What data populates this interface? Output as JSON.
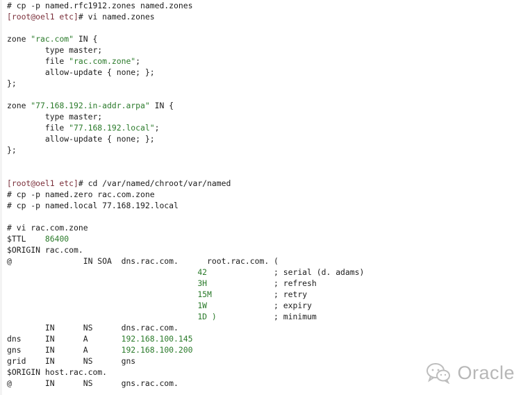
{
  "terminal": {
    "lines": [
      {
        "segments": [
          {
            "t": "# cp -p named.rfc1912.zones named.zones",
            "c": "plain"
          }
        ]
      },
      {
        "segments": [
          {
            "t": "[root@oel1 etc]",
            "c": "prompt"
          },
          {
            "t": "# vi named.zones",
            "c": "plain"
          }
        ]
      },
      {
        "segments": []
      },
      {
        "segments": [
          {
            "t": "zone ",
            "c": "plain"
          },
          {
            "t": "\"rac.com\"",
            "c": "string"
          },
          {
            "t": " IN {",
            "c": "plain"
          }
        ]
      },
      {
        "segments": [
          {
            "t": "        type master;",
            "c": "plain"
          }
        ]
      },
      {
        "segments": [
          {
            "t": "        file ",
            "c": "plain"
          },
          {
            "t": "\"rac.com.zone\"",
            "c": "string"
          },
          {
            "t": ";",
            "c": "plain"
          }
        ]
      },
      {
        "segments": [
          {
            "t": "        allow-update { none; };",
            "c": "plain"
          }
        ]
      },
      {
        "segments": [
          {
            "t": "};",
            "c": "plain"
          }
        ]
      },
      {
        "segments": []
      },
      {
        "segments": [
          {
            "t": "zone ",
            "c": "plain"
          },
          {
            "t": "\"77.168.192.in-addr.arpa\"",
            "c": "string"
          },
          {
            "t": " IN {",
            "c": "plain"
          }
        ]
      },
      {
        "segments": [
          {
            "t": "        type master;",
            "c": "plain"
          }
        ]
      },
      {
        "segments": [
          {
            "t": "        file ",
            "c": "plain"
          },
          {
            "t": "\"77.168.192.local\"",
            "c": "string"
          },
          {
            "t": ";",
            "c": "plain"
          }
        ]
      },
      {
        "segments": [
          {
            "t": "        allow-update { none; };",
            "c": "plain"
          }
        ]
      },
      {
        "segments": [
          {
            "t": "};",
            "c": "plain"
          }
        ]
      },
      {
        "segments": []
      },
      {
        "segments": []
      },
      {
        "segments": [
          {
            "t": "[root@oel1 etc]",
            "c": "prompt"
          },
          {
            "t": "# cd /var/named/chroot/var/named",
            "c": "plain"
          }
        ]
      },
      {
        "segments": [
          {
            "t": "# cp -p named.zero rac.com.zone",
            "c": "plain"
          }
        ]
      },
      {
        "segments": [
          {
            "t": "# cp -p named.local 77.168.192.local",
            "c": "plain"
          }
        ]
      },
      {
        "segments": []
      },
      {
        "segments": [
          {
            "t": "# vi rac.com.zone",
            "c": "plain"
          }
        ]
      },
      {
        "segments": [
          {
            "t": "$TTL    ",
            "c": "plain"
          },
          {
            "t": "86400",
            "c": "string"
          }
        ]
      },
      {
        "segments": [
          {
            "t": "$ORIGIN rac.com.",
            "c": "plain"
          }
        ]
      },
      {
        "segments": [
          {
            "t": "@               IN SOA  dns.rac.com.      root.rac.com. (",
            "c": "plain"
          }
        ]
      },
      {
        "segments": [
          {
            "t": "                                        ",
            "c": "plain"
          },
          {
            "t": "42",
            "c": "string"
          },
          {
            "t": "              ; serial (d. adams)",
            "c": "plain"
          }
        ]
      },
      {
        "segments": [
          {
            "t": "                                        ",
            "c": "plain"
          },
          {
            "t": "3H",
            "c": "string"
          },
          {
            "t": "              ; refresh",
            "c": "plain"
          }
        ]
      },
      {
        "segments": [
          {
            "t": "                                        ",
            "c": "plain"
          },
          {
            "t": "15M",
            "c": "string"
          },
          {
            "t": "             ; retry",
            "c": "plain"
          }
        ]
      },
      {
        "segments": [
          {
            "t": "                                        ",
            "c": "plain"
          },
          {
            "t": "1W",
            "c": "string"
          },
          {
            "t": "              ; expiry",
            "c": "plain"
          }
        ]
      },
      {
        "segments": [
          {
            "t": "                                        ",
            "c": "plain"
          },
          {
            "t": "1D )",
            "c": "string"
          },
          {
            "t": "            ; minimum",
            "c": "plain"
          }
        ]
      },
      {
        "segments": [
          {
            "t": "        IN      NS      dns.rac.com.",
            "c": "plain"
          }
        ]
      },
      {
        "segments": [
          {
            "t": "dns     IN      A       ",
            "c": "plain"
          },
          {
            "t": "192.168.100.145",
            "c": "string"
          }
        ]
      },
      {
        "segments": [
          {
            "t": "gns     IN      A       ",
            "c": "plain"
          },
          {
            "t": "192.168.100.200",
            "c": "string"
          }
        ]
      },
      {
        "segments": [
          {
            "t": "grid    IN      NS      gns",
            "c": "plain"
          }
        ]
      },
      {
        "segments": [
          {
            "t": "$ORIGIN host.rac.com.",
            "c": "plain"
          }
        ]
      },
      {
        "segments": [
          {
            "t": "@       IN      NS      gns.rac.com.",
            "c": "plain"
          }
        ]
      }
    ]
  },
  "watermark": {
    "icon": "wechat-icon",
    "text": "Oracle"
  },
  "colors": {
    "text": "#1b1b1b",
    "string": "#2a7a2a",
    "prompt": "#7a2f3a",
    "watermark": "#b7b7b7"
  }
}
